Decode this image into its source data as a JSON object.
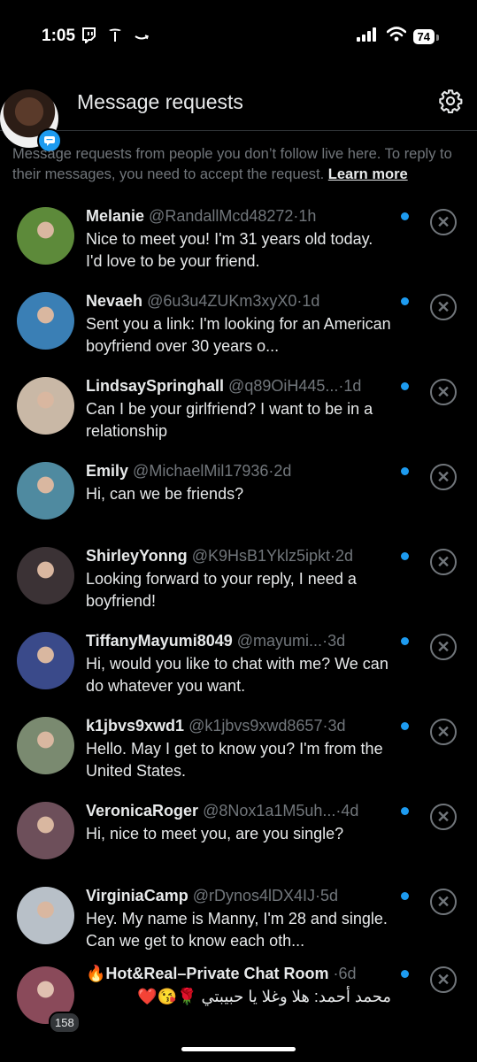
{
  "status": {
    "time": "1:05",
    "battery": "74",
    "icons_left": [
      "twitch-icon",
      "tesla-icon",
      "amazon-icon"
    ],
    "icons_right": [
      "cellular-signal-icon",
      "wifi-icon",
      "battery-icon"
    ]
  },
  "header": {
    "title": "Message requests",
    "settings_icon": "gear-icon"
  },
  "intro": {
    "text": "Message requests from people you don’t follow live here. To reply to their messages, you need to accept the request. ",
    "link": "Learn more"
  },
  "requests": [
    {
      "name": "Melanie",
      "handle": "@RandallMcd48272",
      "time": "1h",
      "text": "Nice to meet you! I'm 31 years old today. I'd love to be your friend.",
      "avatar": "#5d8a3a"
    },
    {
      "name": "Nevaeh",
      "handle": "@6u3u4ZUKm3xyX0",
      "time": "1d",
      "text": "Sent you a link: I'm looking for an American boyfriend over 30 years o...",
      "avatar": "#3a7fb5"
    },
    {
      "name": "LindsaySpringhall",
      "handle": "@q89OiH445...",
      "time": "1d",
      "text": "Can I be your girlfriend? I want to be in a relationship",
      "avatar": "#c9b8a6"
    },
    {
      "name": "Emily",
      "handle": "@MichaelMil17936",
      "time": "2d",
      "text": "Hi, can we be friends?",
      "avatar": "#4f8aa0"
    },
    {
      "name": "ShirleyYonng",
      "handle": "@K9HsB1Yklz5ipkt",
      "time": "2d",
      "text": "Looking forward to your reply, I need a boyfriend!",
      "avatar": "#3b3235"
    },
    {
      "name": "TiffanyMayumi8049",
      "handle": "@mayumi...",
      "time": "3d",
      "text": "Hi, would you like to chat with me? We can do whatever you want.",
      "avatar": "#3a4a8a"
    },
    {
      "name": "k1jbvs9xwd1",
      "handle": "@k1jbvs9xwd8657",
      "time": "3d",
      "text": "Hello. May I get to know you? I'm from the United States.",
      "avatar": "#7a8a70"
    },
    {
      "name": "VeronicaRoger",
      "handle": "@8Nox1a1M5uh...",
      "time": "4d",
      "text": "Hi, nice to meet you, are you single?",
      "avatar": "#6d4f5a"
    },
    {
      "name": "VirginiaCamp",
      "handle": "@rDynos4lDX4IJ",
      "time": "5d",
      "text": "Hey. My name is Manny, I'm 28 and single. Can we get to know each oth...",
      "avatar": "#b8c0c8"
    }
  ],
  "group": {
    "name": "🔥Hot&Real–Private Chat Room",
    "time": "6d",
    "text": "محمد أحمد: هلا وغلا يا حبيبتي 🌹😘❤️",
    "count": "158",
    "avatar": "#8a4a5a"
  },
  "separator": "·",
  "dismiss_icon": "close-circle-icon",
  "colors": {
    "accent": "#1d9bf0",
    "muted": "#71767b",
    "text": "#e7e9ea",
    "bg": "#000000"
  }
}
